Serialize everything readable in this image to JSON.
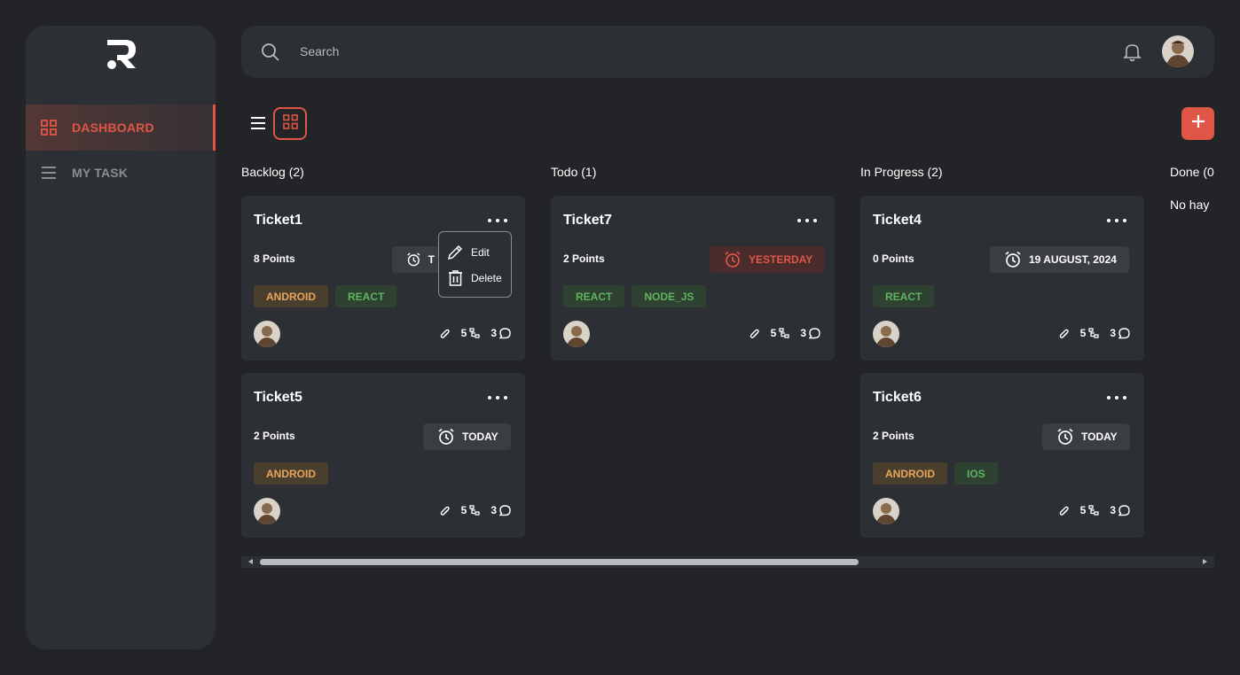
{
  "colors": {
    "accent": "#e05646",
    "bg": "#222427",
    "panel": "#2c2f33",
    "tag_android": "#e8a65b",
    "tag_green": "#5fb361"
  },
  "sidebar": {
    "logo_icon": "r-logo-icon",
    "items": [
      {
        "label": "DASHBOARD",
        "icon": "grid-icon",
        "active": true
      },
      {
        "label": "MY TASK",
        "icon": "menu-icon",
        "active": false
      }
    ]
  },
  "topbar": {
    "search": {
      "placeholder": "Search",
      "value": ""
    },
    "bell_icon": "bell-icon",
    "avatar": "user-avatar"
  },
  "toolbar": {
    "list_view_icon": "list-icon",
    "grid_view_icon": "grid-icon",
    "add_icon": "plus-icon"
  },
  "columns": [
    {
      "title": "Backlog (2)"
    },
    {
      "title": "Todo (1)"
    },
    {
      "title": "In Progress (2)"
    },
    {
      "title": "Done (0",
      "empty_text": "No hay"
    }
  ],
  "cards": [
    {
      "title": "Ticket1",
      "points": "8 Points",
      "due": "T",
      "tags": [
        "ANDROID",
        "REACT"
      ],
      "attachments": "",
      "subtasks": "5",
      "comments": "3"
    },
    {
      "title": "Ticket5",
      "points": "2 Points",
      "due": "TODAY",
      "tags": [
        "ANDROID"
      ],
      "attachments": "",
      "subtasks": "5",
      "comments": "3"
    },
    {
      "title": "Ticket7",
      "points": "2 Points",
      "due": "YESTERDAY",
      "tags": [
        "REACT",
        "NODE_JS"
      ],
      "attachments": "",
      "subtasks": "5",
      "comments": "3"
    },
    {
      "title": "Ticket4",
      "points": "0 Points",
      "due": "19 AUGUST, 2024",
      "tags": [
        "REACT"
      ],
      "attachments": "",
      "subtasks": "5",
      "comments": "3"
    },
    {
      "title": "Ticket6",
      "points": "2 Points",
      "due": "TODAY",
      "tags": [
        "ANDROID",
        "IOS"
      ],
      "attachments": "",
      "subtasks": "5",
      "comments": "3"
    }
  ],
  "context_menu": {
    "edit": "Edit",
    "delete": "Delete"
  }
}
